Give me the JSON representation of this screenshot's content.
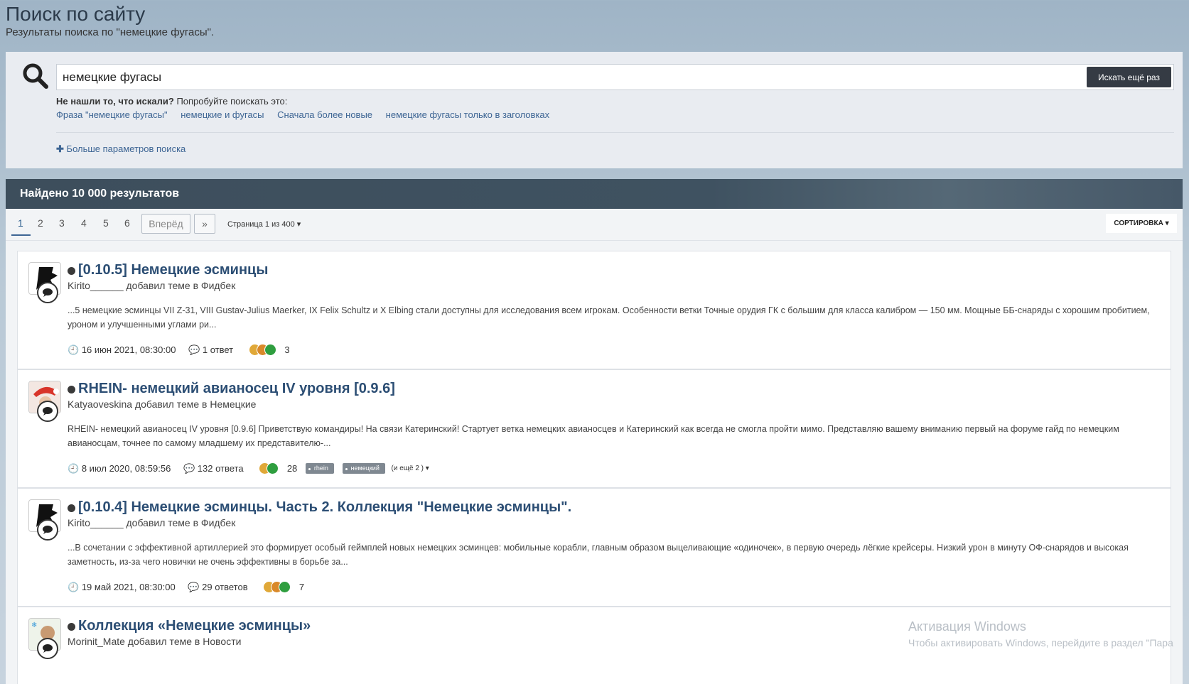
{
  "page": {
    "title": "Поиск по сайту",
    "subtitle": "Результаты поиска по \"немецкие фугасы\"."
  },
  "search": {
    "query": "немецкие фугасы",
    "button": "Искать ещё раз",
    "hint_bold": "Не нашли то, что искали?",
    "hint_rest": " Попробуйте поискать это:",
    "suggestions": [
      "Фраза \"немецкие фугасы\"",
      "немецкие и фугасы",
      "Сначала более новые",
      "немецкие фугасы только в заголовках"
    ],
    "more_params": "Больше параметров поиска"
  },
  "results_header": "Найдено 10 000 результатов",
  "pagination": {
    "pages": [
      "1",
      "2",
      "3",
      "4",
      "5",
      "6"
    ],
    "next": "Вперёд",
    "last": "»",
    "page_of": "Страница 1 из 400",
    "sort": "СОРТИРОВКА"
  },
  "results": [
    {
      "title": "[0.10.5] Немецкие эсминцы",
      "by": "Kirito______ добавил теме в Фидбек",
      "snippet": "...5 немецкие эсминцы VII Z-31, VIII Gustav-Julius Maerker, IX Felix Schultz и X Elbing стали доступны для исследования всем игрокам. Особенности ветки Точные орудия ГК с большим для класса калибром — 150 мм. Мощные ББ-снаряды с хорошим пробитием, уроном и улучшенными углами ри...",
      "date": "16 июн 2021, 08:30:00",
      "replies": "1 ответ",
      "reactions": "3"
    },
    {
      "title": "RHEIN- немецкий авианосец IV уровня [0.9.6]",
      "by": "Katyaoveskina добавил теме в Немецкие",
      "snippet": "RHEIN- немецкий авианосец IV уровня [0.9.6] Приветствую командиры! На связи Катеринский! Стартует ветка немецких авианосцев и Катеринский как всегда не смогла пройти мимо. Представляю вашему вниманию первый на форуме гайд по немецким авианосцам, точнее по самому младшему их представителю-...",
      "date": "8 июл 2020, 08:59:56",
      "replies": "132 ответа",
      "reactions": "28",
      "tags": [
        "rhein",
        "немецкий"
      ],
      "more_tags": "(и ещё 2 )"
    },
    {
      "title": "[0.10.4] Немецкие эсминцы. Часть 2. Коллекция \"Немецкие эсминцы\".",
      "by": "Kirito______ добавил теме в Фидбек",
      "snippet": "...В сочетании с эффективной артиллерией это формирует особый геймплей новых немецких эсминцев: мобильные корабли, главным образом выцеливающие «одиночек», в первую очередь лёгкие крейсеры. Низкий урон в минуту ОФ-снарядов и высокая заметность, из-за чего новички не очень эффективны в борьбе за...",
      "date": "19 май 2021, 08:30:00",
      "replies": "29 ответов",
      "reactions": "7"
    },
    {
      "title": "Коллекция «Немецкие эсминцы»",
      "by": "Morinit_Mate добавил теме в Новости"
    }
  ],
  "watermark": {
    "title": "Активация Windows",
    "subtitle": "Чтобы активировать Windows, перейдите в раздел \"Пара"
  },
  "colors": {
    "link": "#3d6594",
    "title": "#2c4e74",
    "header_bar": "#3d4e5c",
    "button_dark": "#353b44"
  }
}
